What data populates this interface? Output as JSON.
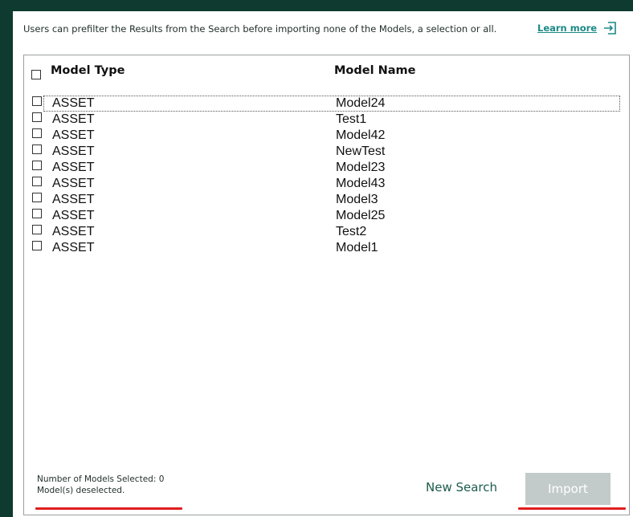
{
  "intro_text": "Users can prefilter the Results from the Search before importing none of the Models, a selection or all.",
  "learn_more": "Learn more",
  "table": {
    "headers": {
      "type": "Model Type",
      "name": "Model Name"
    },
    "rows": [
      {
        "type": "ASSET",
        "name": "Model24"
      },
      {
        "type": "ASSET",
        "name": "Test1"
      },
      {
        "type": "ASSET",
        "name": "Model42"
      },
      {
        "type": "ASSET",
        "name": "NewTest"
      },
      {
        "type": "ASSET",
        "name": "Model23"
      },
      {
        "type": "ASSET",
        "name": "Model43"
      },
      {
        "type": "ASSET",
        "name": "Model3"
      },
      {
        "type": "ASSET",
        "name": "Model25"
      },
      {
        "type": "ASSET",
        "name": "Test2"
      },
      {
        "type": "ASSET",
        "name": "Model1"
      }
    ]
  },
  "status": {
    "selected_count": "Number of Models Selected: 0",
    "deselected": "Model(s) deselected."
  },
  "buttons": {
    "new_search": "New Search",
    "import": "Import"
  },
  "colors": {
    "background": "#0f3a2f",
    "link": "#1a8a86",
    "annotation": "#e01e1e",
    "disabled_button": "#c3cbca"
  }
}
